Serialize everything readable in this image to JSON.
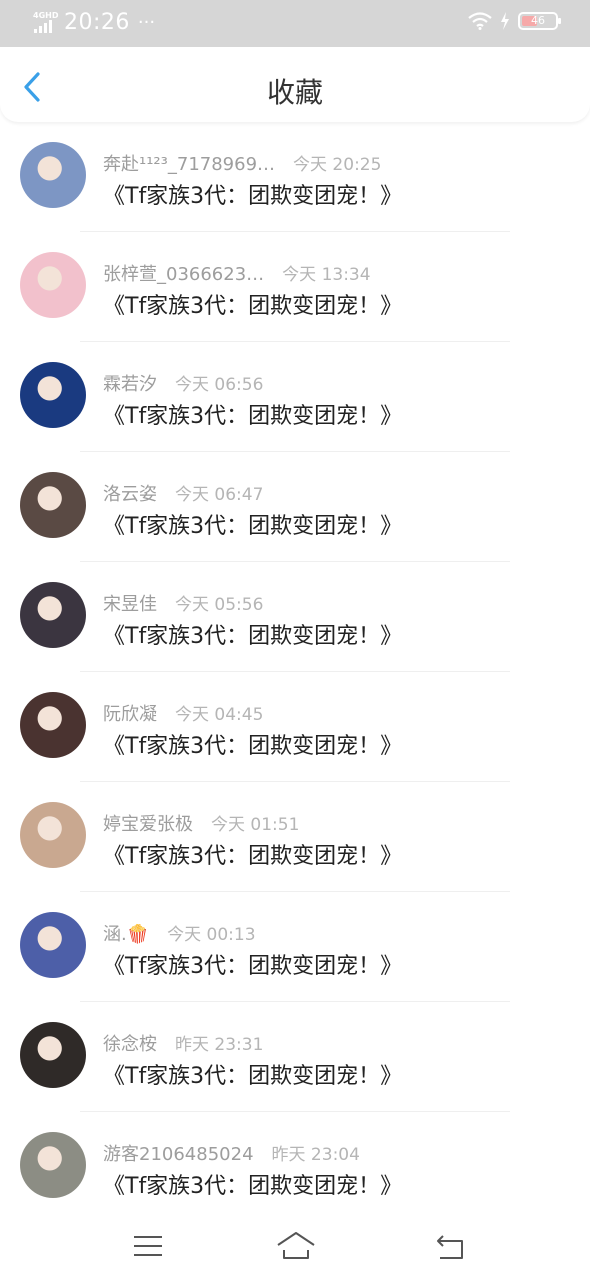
{
  "status_bar": {
    "network": "4GHD",
    "time": "20:26",
    "dots": "···",
    "battery": "46",
    "battery_level": 0.46
  },
  "header": {
    "title": "收藏"
  },
  "items": [
    {
      "user": "奔赴¹¹²³_7178969…",
      "time": "今天 20:25",
      "book": "《Tf家族3代：团欺变团宠！》",
      "avatar_color": "#7d96c4"
    },
    {
      "user": "张梓萱_0366623…",
      "time": "今天 13:34",
      "book": "《Tf家族3代：团欺变团宠！》",
      "avatar_color": "#f2c1cc"
    },
    {
      "user": "霖若汐",
      "time": "今天 06:56",
      "book": "《Tf家族3代：团欺变团宠！》",
      "avatar_color": "#1a3a80"
    },
    {
      "user": "洛云姿",
      "time": "今天 06:47",
      "book": "《Tf家族3代：团欺变团宠！》",
      "avatar_color": "#5a4a44"
    },
    {
      "user": "宋昱佳",
      "time": "今天 05:56",
      "book": "《Tf家族3代：团欺变团宠！》",
      "avatar_color": "#3b3540"
    },
    {
      "user": "阮欣凝",
      "time": "今天 04:45",
      "book": "《Tf家族3代：团欺变团宠！》",
      "avatar_color": "#4a3330"
    },
    {
      "user": "婷宝爱张极",
      "time": "今天 01:51",
      "book": "《Tf家族3代：团欺变团宠！》",
      "avatar_color": "#c9a890"
    },
    {
      "user": "涵.🍿",
      "time": "今天 00:13",
      "book": "《Tf家族3代：团欺变团宠！》",
      "avatar_color": "#4d5fa8"
    },
    {
      "user": "徐念桉",
      "time": "昨天 23:31",
      "book": "《Tf家族3代：团欺变团宠！》",
      "avatar_color": "#2f2a28"
    },
    {
      "user": "游客2106485024",
      "time": "昨天 23:04",
      "book": "《Tf家族3代：团欺变团宠！》",
      "avatar_color": "#8c8d84"
    }
  ],
  "colors": {
    "accent": "#3aa0e8",
    "status_bar_bg": "#d6d6d6",
    "muted_text": "#9d9d9d"
  }
}
